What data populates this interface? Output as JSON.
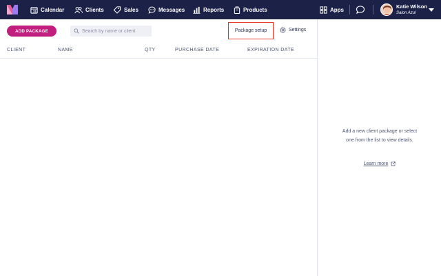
{
  "nav": {
    "items": [
      {
        "label": "Calendar",
        "icon": "calendar-icon"
      },
      {
        "label": "Clients",
        "icon": "clients-icon"
      },
      {
        "label": "Sales",
        "icon": "sales-tag-icon"
      },
      {
        "label": "Messages",
        "icon": "messages-icon"
      },
      {
        "label": "Reports",
        "icon": "reports-icon"
      },
      {
        "label": "Products",
        "icon": "products-icon"
      }
    ],
    "apps_label": "Apps",
    "user_name": "Katie Wilson",
    "user_org": "Salon Azul"
  },
  "toolbar": {
    "add_package_label": "ADD PACKAGE",
    "search_placeholder": "Search by name or client",
    "package_setup_label": "Package setup",
    "settings_label": "Settings"
  },
  "table": {
    "columns": [
      "CLIENT",
      "NAME",
      "QTY",
      "PURCHASE DATE",
      "EXPIRATION DATE"
    ],
    "rows": []
  },
  "detail_panel": {
    "empty_message": "Add a new client package or select one from the list to view details.",
    "learn_more_label": "Learn more"
  },
  "colors": {
    "navbar": "#1c2148",
    "accent": "#c01f7e",
    "highlight_box": "#e8362b"
  }
}
